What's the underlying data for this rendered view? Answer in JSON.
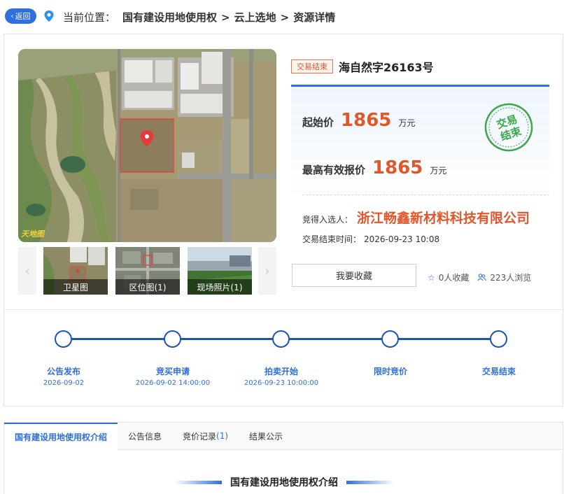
{
  "nav": {
    "back_label": "返回",
    "location_label": "当前位置：",
    "crumbs": [
      "国有建设用地使用权",
      "云上选地",
      "资源详情"
    ],
    "crumb_separator": ">"
  },
  "lot": {
    "status": "交易结束",
    "title": "海自然字26163号",
    "start_price_label": "起始价",
    "start_price": "1865",
    "start_price_unit": "万元",
    "top_bid_label": "最高有效报价",
    "top_bid": "1865",
    "top_bid_unit": "万元",
    "stamp_text_line1": "交易",
    "stamp_text_line2": "结束",
    "winner_label": "竞得入选人：",
    "winner": "浙江畅鑫新材料科技有限公司",
    "end_time_label": "交易结束时间：",
    "end_time": "2026-09-23 10:08"
  },
  "media": {
    "map_watermark": "天地图",
    "thumbs": [
      {
        "label": "卫星图"
      },
      {
        "label": "区位图(1)"
      },
      {
        "label": "现场照片(1)"
      }
    ],
    "prev_icon": "chevron-left-icon",
    "next_icon": "chevron-right-icon"
  },
  "actions": {
    "favorite_label": "我要收藏",
    "favorites_count": "0人收藏",
    "views_count": "223人浏览"
  },
  "timeline": [
    {
      "label": "公告发布",
      "date": "2026-09-02"
    },
    {
      "label": "竞买申请",
      "date": "2026-09-02 14:00:00"
    },
    {
      "label": "拍卖开始",
      "date": "2026-09-23 10:00:00"
    },
    {
      "label": "限时竞价",
      "date": ""
    },
    {
      "label": "交易结束",
      "date": ""
    }
  ],
  "tabs": [
    {
      "label": "国有建设用地使用权介绍",
      "count": ""
    },
    {
      "label": "公告信息",
      "count": ""
    },
    {
      "label": "竞价记录",
      "count": "(1)"
    },
    {
      "label": "结果公示",
      "count": ""
    }
  ],
  "section": {
    "title": "国有建设用地使用权介绍"
  },
  "colors": {
    "accent": "#2f6fe0",
    "timeline": "#1c55b7",
    "price": "#e2572a",
    "stamp": "#3aa84a"
  }
}
